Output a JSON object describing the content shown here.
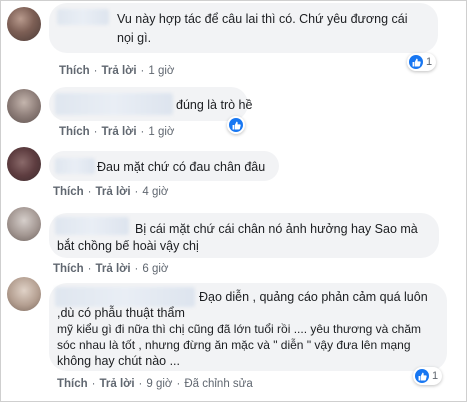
{
  "comments": [
    {
      "text_lines": [
        "Vu này hợp tác để câu lai thì có. Chứ yêu đương cái",
        "nọi gì."
      ],
      "like_label": "Thích",
      "reply_label": "Trả lời",
      "time": "1 giờ",
      "reaction_count": "1"
    },
    {
      "text_lines": [
        "đúng là trò hề"
      ],
      "like_label": "Thích",
      "reply_label": "Trả lời",
      "time": "1 giờ",
      "reaction_count": ""
    },
    {
      "text_lines": [
        "Đau mặt chứ có đau chân đâu"
      ],
      "like_label": "Thích",
      "reply_label": "Trả lời",
      "time": "4 giờ"
    },
    {
      "text_lines": [
        "Bị cái mặt chứ cái chân nó ảnh hưởng hay Sao mà",
        "bắt chồng bế hoài vậy chị"
      ],
      "like_label": "Thích",
      "reply_label": "Trả lời",
      "time": "6 giờ"
    },
    {
      "text_lines": [
        "Đạo diễn , quảng cáo phản cảm quá luôn",
        ",dù có phẫu thuật thẩm",
        "mỹ kiểu gì đi nữa thì chị cũng đã lớn tuổi rồi .... yêu thương và chăm",
        "sóc nhau là tốt , nhưng đừng ăn mặc và \" diễn \" vậy đưa lên mạng",
        "không hay chút nào ..."
      ],
      "like_label": "Thích",
      "reply_label": "Trả lời",
      "time": "9 giờ",
      "edited_label": "Đã chỉnh sửa",
      "reaction_count": "1"
    }
  ],
  "colors": {
    "bubble": "#f2f3f5",
    "action_text": "#606770",
    "like_blue": "#1877f2"
  }
}
